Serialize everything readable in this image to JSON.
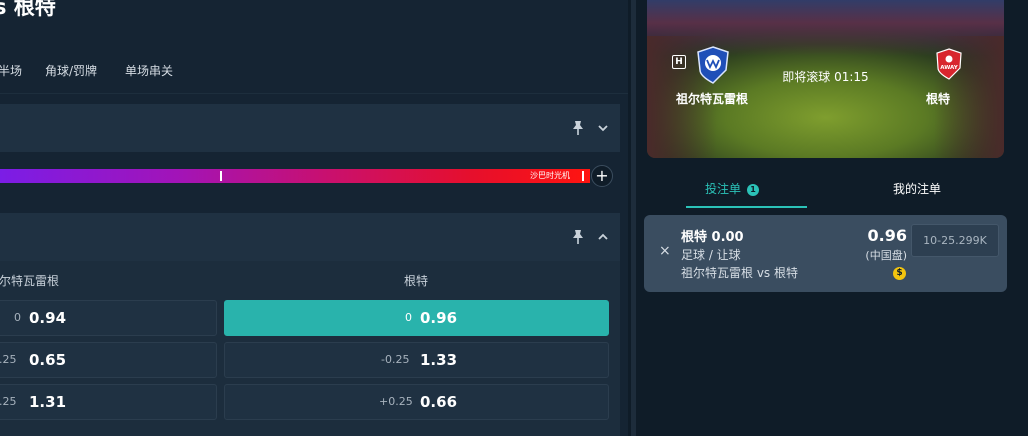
{
  "match": {
    "title": "s 根特"
  },
  "tabs": [
    "半场",
    "角球/罚牌",
    "单场串关"
  ],
  "momentum": {
    "label": "沙巴时光机",
    "add_label": "+"
  },
  "handicap_market": {
    "home_team": "尔特瓦雷根",
    "away_team": "根特",
    "rows": [
      {
        "home_line": "0",
        "home_odds": "0.94",
        "away_line": "0",
        "away_odds": "0.96",
        "away_selected": true
      },
      {
        "home_line": ".25",
        "home_odds": "0.65",
        "away_line": "-0.25",
        "away_odds": "1.33",
        "away_selected": false
      },
      {
        "home_line": ".25",
        "home_odds": "1.31",
        "away_line": "+0.25",
        "away_odds": "0.66",
        "away_selected": false
      }
    ]
  },
  "hero": {
    "home_badge": "H",
    "status": "即将滚球 01:15",
    "home_team": "祖尔特瓦雷根",
    "away_team": "根特",
    "away_crest_text": "AWAY"
  },
  "right_tabs": {
    "betslip": "投注单",
    "betslip_count": "1",
    "my_bets": "我的注单"
  },
  "bet_slip": {
    "remove_icon": "×",
    "pick": "根特 0.00",
    "market": "足球 / 让球",
    "event": "祖尔特瓦雷根 vs 根特",
    "odds": "0.96",
    "odds_format": "(中国盘)",
    "coin_icon": "$",
    "stake_placeholder": "10-25.299K"
  },
  "icons": {
    "pin": "pin-icon",
    "chevron_down": "chevron-down-icon",
    "chevron_up": "chevron-up-icon",
    "close": "close-icon",
    "coin": "coin-icon"
  },
  "colors": {
    "accent": "#29b3ac",
    "panel": "#1f3142",
    "background": "#0f1c28",
    "coin": "#f3c50f"
  }
}
